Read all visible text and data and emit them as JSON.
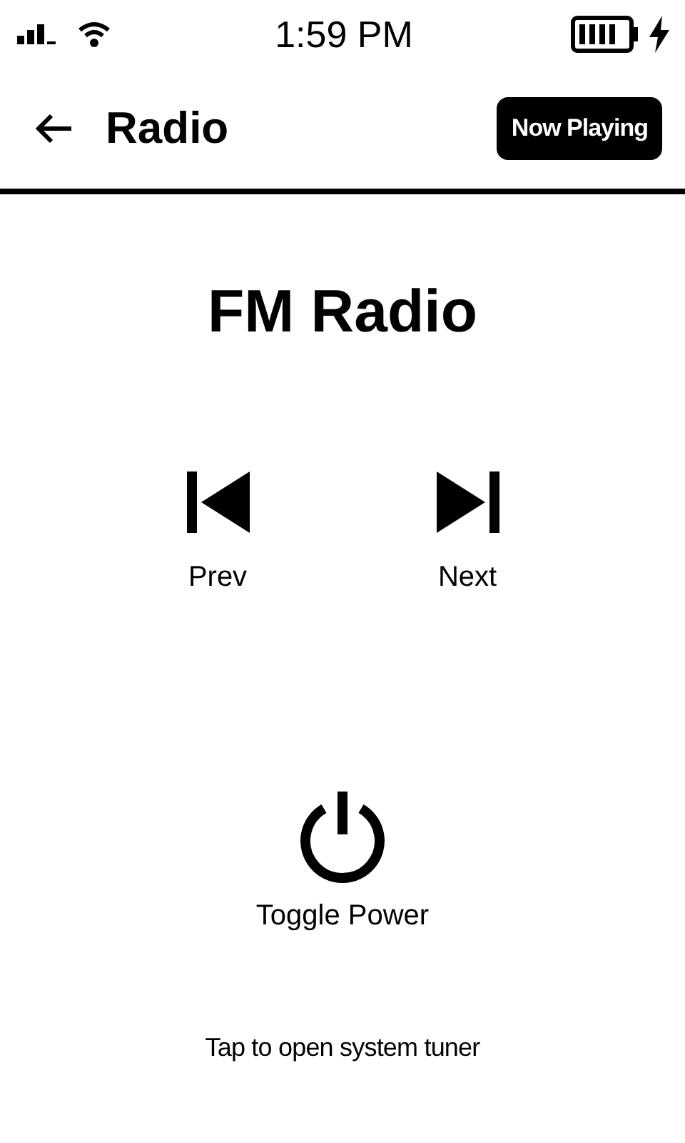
{
  "status_bar": {
    "time": "1:59 PM"
  },
  "header": {
    "title": "Radio",
    "action": "Now Playing"
  },
  "heading": "FM Radio",
  "controls": [
    {
      "kind": "prev",
      "label": "Prev"
    },
    {
      "kind": "next",
      "label": "Next"
    }
  ],
  "power": {
    "label": "Toggle Power"
  },
  "footer_link": "Tap to open system tuner"
}
